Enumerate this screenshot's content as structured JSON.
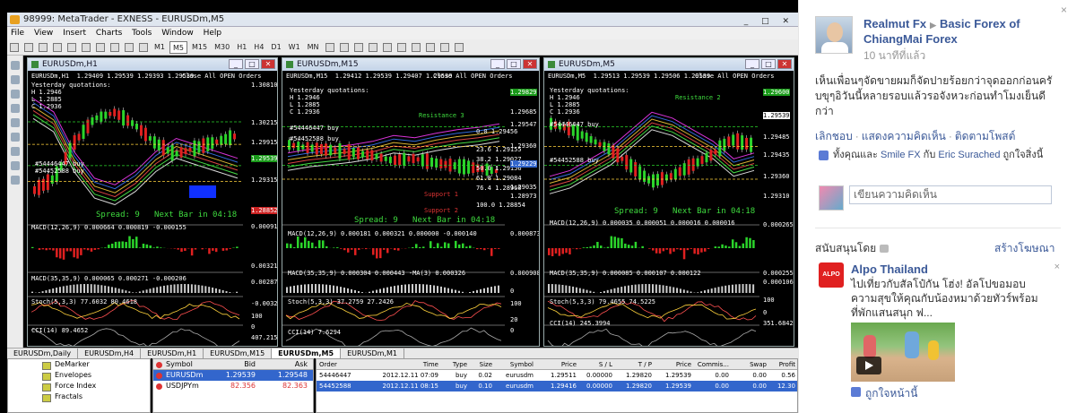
{
  "mt4": {
    "title": "98999: MetaTrader - EXNESS - EURUSDm,M5",
    "menu": [
      "File",
      "View",
      "Insert",
      "Charts",
      "Tools",
      "Window",
      "Help"
    ],
    "timeframes": [
      "M1",
      "M5",
      "M15",
      "M30",
      "H1",
      "H4",
      "D1",
      "W1",
      "MN"
    ],
    "active_timeframe": "M5",
    "windows": [
      {
        "title": "EURUSDm,H1",
        "header": "EURUSDm,H1  1.29409 1.29539 1.29393 1.29539",
        "close_all": "Close All OPEN Orders",
        "quotes": "Yesterday quotations:\nH 1.2946\nL 1.2885\nC 1.2936",
        "buy1": "#54446447 buy",
        "buy2": "#54452588 buy",
        "spread": "Spread: 9   Next Bar in 04:18",
        "macd": "MACD(12,26,9) 0.000664 0.000819 -0.000155",
        "macd2": "MACD(35,35,9) 0.000065 0.000271 -0.000206",
        "stoch": "Stoch(5,3,3) 77.6032 80.4618",
        "cci": "CCI(14) 89.4652",
        "prices": [
          "1.30810",
          "1.30215",
          "1.29915",
          "1.29539",
          "1.29315",
          "1.28852"
        ],
        "osc_vals": [
          "0.000919",
          "0.003212",
          "0.002871",
          "-0.003212",
          "100",
          "0",
          "407.215"
        ]
      },
      {
        "title": "EURUSDm,M15",
        "header": "EURUSDm,M15  1.29412 1.29539 1.29407 1.29539",
        "close_all": "Close All OPEN Orders",
        "quotes": "Yesterday quotations:\nH 1.2946\nL 1.2885\nC 1.2936",
        "buy1": "#54446447 buy",
        "buy2": "#54452588 buy",
        "resistance": "Resistance 3",
        "support1": "Support 1",
        "support2": "Support 2",
        "fibs": [
          "0.0 1.29456",
          "23.6 1.29155",
          "38.2 1.29027",
          "50.0 1.29156",
          "61.8 1.29084",
          "76.4 1.28960",
          "100.0 1.28854"
        ],
        "spread": "Spread: 9   Next Bar in 04:18",
        "macd": "MACD(12,26,9) 0.000181 0.000321 0.000000 -0.000140",
        "macd2": "MACD(35,35,9) 0.000304 0.000443 -MA(3) 0.000326",
        "stoch": "Stoch(5,3,3) 37.2759 27.2426",
        "cci": "CCI(14) 7.6294",
        "prices": [
          "1.29829",
          "1.29685",
          "1.29547",
          "1.29360",
          "1.29229",
          "1.29035",
          "1.28973"
        ],
        "osc_vals": [
          "0.000873",
          "0.000908",
          "0",
          "100",
          "20",
          "0"
        ]
      },
      {
        "title": "EURUSDm,M5",
        "header": "EURUSDm,M5  1.29513 1.29539 1.29506 1.29539",
        "close_all": "Close All OPEN Orders",
        "quotes": "Yesterday quotations:\nH 1.2946\nL 1.2885\nC 1.2936",
        "buy1": "#54446447 buy",
        "buy2": "#54452588 buy",
        "resistance": "Resistance 2",
        "spread": "Spread: 9   Next Bar in 04:18",
        "macd": "MACD(12,26,9) 0.000035 0.000051 0.000016 0.000016",
        "macd2": "MACD(35,35,9) 0.000085 0.000107 0.000122",
        "stoch": "Stoch(5,3,3) 79.4655 74.5225",
        "cci": "CCI(14) 245.3994",
        "prices": [
          "1.29600",
          "1.29539",
          "1.29485",
          "1.29435",
          "1.29360",
          "1.29310"
        ],
        "osc_vals": [
          "0.000265",
          "0.000255",
          "0.000106",
          "100",
          "0",
          "351.6842"
        ]
      }
    ],
    "tabs": [
      "EURUSDm,Daily",
      "EURUSDm,H4",
      "EURUSDm,H1",
      "EURUSDm,M15",
      "EURUSDm,M5",
      "EURUSDm,M1"
    ],
    "active_tab": "EURUSDm,M5",
    "navigator": [
      "DeMarker",
      "Envelopes",
      "Force Index",
      "Fractals"
    ],
    "market_watch": {
      "headers": [
        "Symbol",
        "Bid",
        "Ask"
      ],
      "rows": [
        {
          "symbol": "EURUSDm",
          "bid": "1.29539",
          "ask": "1.29548",
          "selected": true
        },
        {
          "symbol": "USDJPYm",
          "bid": "82.356",
          "ask": "82.363",
          "selected": false
        }
      ]
    },
    "terminal": {
      "headers": [
        "Order",
        "Time",
        "Type",
        "Size",
        "Symbol",
        "Price",
        "S / L",
        "T / P",
        "Price",
        "Commis...",
        "Swap",
        "Profit"
      ],
      "rows": [
        [
          "54446447",
          "2012.12.11 07:09",
          "buy",
          "0.02",
          "eurusdm",
          "1.29511",
          "0.00000",
          "1.29820",
          "1.29539",
          "0.00",
          "0.00",
          "0.56"
        ],
        [
          "54452588",
          "2012.12.11 08:15",
          "buy",
          "0.10",
          "eurusdm",
          "1.29416",
          "0.00000",
          "1.29820",
          "1.29539",
          "0.00",
          "0.00",
          "12.30"
        ]
      ]
    }
  },
  "facebook": {
    "author": "Realmut Fx",
    "page": "Basic Forex of ChiangMai Forex",
    "time": "10 นาทีที่แล้ว",
    "post_text": "เห็นเพื่อนๆจัดขายผมก็จัดปายร้อยกว่าจุดออกก่อนครับขุๆอิวันนี้หลายรอบแล้วรอจังหวะก่อนทำโมงเย็นดีกว่า",
    "actions": [
      "เลิกชอบ",
      "แสดงความคิดเห็น",
      "ติดตามโพสต์"
    ],
    "likes_prefix": "ทั้งคุณและ ",
    "liker1": "Smile FX",
    "likes_mid": " กับ ",
    "liker2": "Eric Surached",
    "likes_suffix": " ถูกใจสิ่งนี้",
    "comment_placeholder": "เขียนความคิดเห็น",
    "sponsored_label": "สนับสนุนโดย",
    "create_ad": "สร้างโฆษณา",
    "ad": {
      "logo_text": "ALPO",
      "title": "Alpo Thailand",
      "text": "ไปเที่ยวกับสัลโป๋กัน โฮ่ง! อัลโปขอมอบความสุขให้คุณกับน้องหมาด้วยทัวร์พร้อมที่พักแสนสนุก ฟ...",
      "like": "ถูกใจหน้านี้"
    },
    "close": "×"
  }
}
